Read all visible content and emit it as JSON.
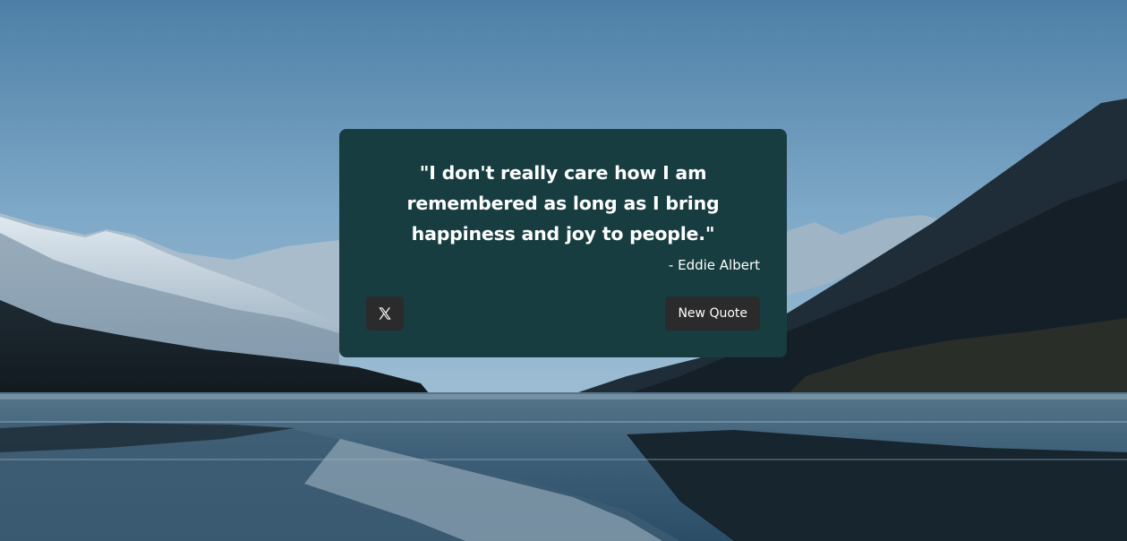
{
  "background": {
    "icon": "mountain-lake-landscape"
  },
  "quote": {
    "text": "\"I don't really care how I am remembered as long as I bring happiness and joy to people.\"",
    "author": "- Eddie Albert"
  },
  "actions": {
    "tweet_icon": "x-logo-icon",
    "new_quote_label": "New Quote"
  },
  "colors": {
    "card": "#173d40",
    "button": "#2b2b2b",
    "text": "#ffffff"
  }
}
